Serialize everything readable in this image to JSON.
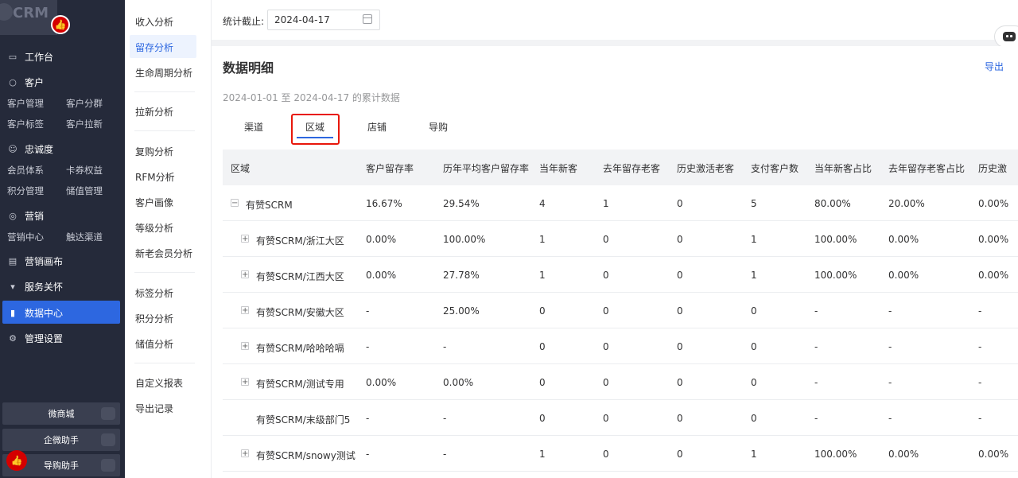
{
  "brand": {
    "logo_text": "CRM"
  },
  "sidebar": {
    "groups": [
      {
        "label": "工作台",
        "icon": "chat-icon",
        "subs": []
      },
      {
        "label": "客户",
        "icon": "user-icon",
        "subs": [
          "客户管理",
          "客户分群",
          "客户标签",
          "客户拉新"
        ]
      },
      {
        "label": "忠诚度",
        "icon": "smile-icon",
        "subs": [
          "会员体系",
          "卡券权益",
          "积分管理",
          "储值管理"
        ]
      },
      {
        "label": "营销",
        "icon": "marketing-icon",
        "subs": [
          "营销中心",
          "触达渠道"
        ]
      },
      {
        "label": "营销画布",
        "icon": "canvas-icon",
        "subs": []
      },
      {
        "label": "服务关怀",
        "icon": "tie-icon",
        "subs": []
      },
      {
        "label": "数据中心",
        "icon": "bar-chart-icon",
        "subs": []
      },
      {
        "label": "管理设置",
        "icon": "gear-icon",
        "subs": []
      }
    ],
    "quick_links": [
      "微商城",
      "企微助手",
      "导购助手"
    ]
  },
  "submenu": {
    "items": [
      "收入分析",
      "留存分析",
      "生命周期分析",
      "拉新分析",
      "复购分析",
      "RFM分析",
      "客户画像",
      "等级分析",
      "新老会员分析",
      "标签分析",
      "积分分析",
      "储值分析",
      "自定义报表",
      "导出记录"
    ],
    "active": "留存分析"
  },
  "filter": {
    "label": "统计截止:",
    "date": "2024-04-17"
  },
  "card": {
    "title": "数据明细",
    "export_label": "导出",
    "range_text": "2024-01-01 至 2024-04-17 的累计数据",
    "tabs": [
      "渠道",
      "区域",
      "店铺",
      "导购"
    ],
    "active_tab": "区域"
  },
  "table": {
    "columns": [
      "区域",
      "客户留存率",
      "历年平均客户留存率",
      "当年新客",
      "去年留存老客",
      "历史激活老客",
      "支付客户数",
      "当年新客占比",
      "去年留存老客占比",
      "历史激"
    ],
    "rows": [
      {
        "expander": "−",
        "level": 0,
        "cells": [
          "有赞SCRM",
          "16.67%",
          "29.54%",
          "4",
          "1",
          "0",
          "5",
          "80.00%",
          "20.00%",
          "0.00%"
        ]
      },
      {
        "expander": "+",
        "level": 1,
        "cells": [
          "有赞SCRM/浙江大区",
          "0.00%",
          "100.00%",
          "1",
          "0",
          "0",
          "1",
          "100.00%",
          "0.00%",
          "0.00%"
        ]
      },
      {
        "expander": "+",
        "level": 1,
        "cells": [
          "有赞SCRM/江西大区",
          "0.00%",
          "27.78%",
          "1",
          "0",
          "0",
          "1",
          "100.00%",
          "0.00%",
          "0.00%"
        ]
      },
      {
        "expander": "+",
        "level": 1,
        "cells": [
          "有赞SCRM/安徽大区",
          "-",
          "25.00%",
          "0",
          "0",
          "0",
          "0",
          "-",
          "-",
          "-"
        ]
      },
      {
        "expander": "+",
        "level": 1,
        "cells": [
          "有赞SCRM/哈哈哈嗝",
          "-",
          "-",
          "0",
          "0",
          "0",
          "0",
          "-",
          "-",
          "-"
        ]
      },
      {
        "expander": "+",
        "level": 1,
        "cells": [
          "有赞SCRM/测试专用",
          "0.00%",
          "0.00%",
          "0",
          "0",
          "0",
          "0",
          "-",
          "-",
          "-"
        ]
      },
      {
        "expander": "",
        "level": 1,
        "cells": [
          "有赞SCRM/末级部门5",
          "-",
          "-",
          "0",
          "0",
          "0",
          "0",
          "-",
          "-",
          "-"
        ]
      },
      {
        "expander": "+",
        "level": 1,
        "cells": [
          "有赞SCRM/snowy测试",
          "-",
          "-",
          "1",
          "0",
          "0",
          "1",
          "100.00%",
          "0.00%",
          "0.00%"
        ]
      }
    ]
  }
}
